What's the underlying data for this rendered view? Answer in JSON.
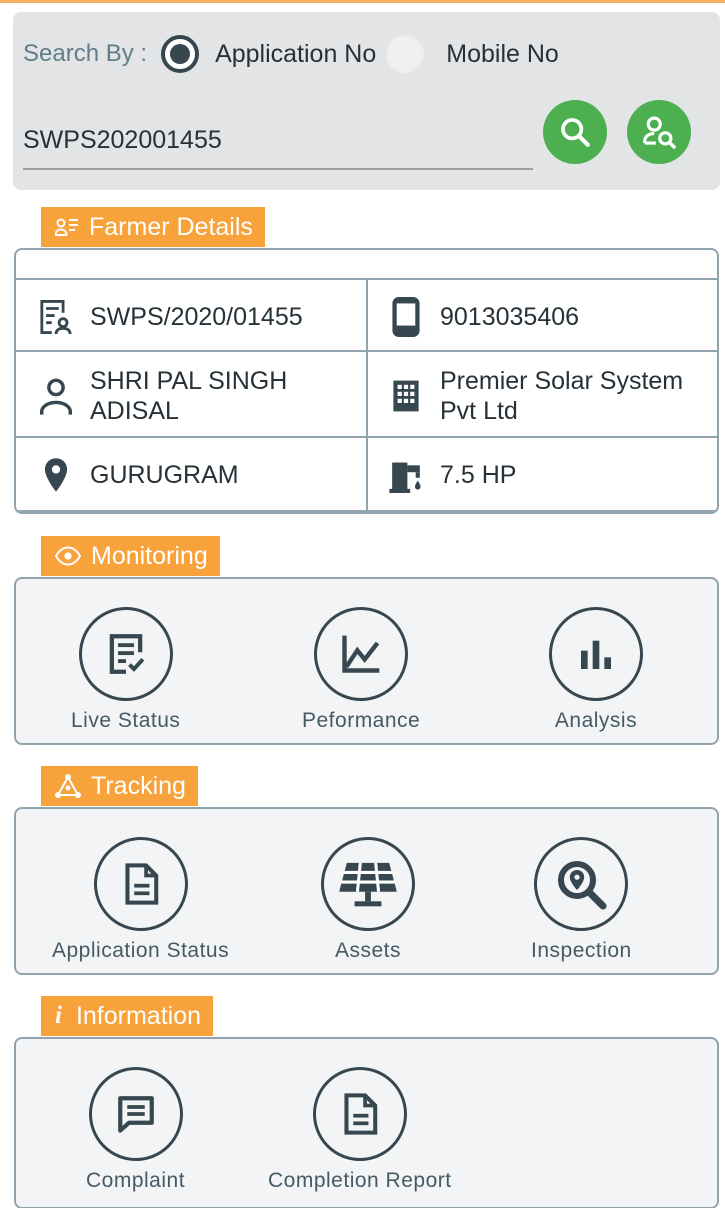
{
  "search": {
    "label": "Search By :",
    "option_application": "Application No",
    "option_mobile": "Mobile No",
    "selected": "Application No",
    "value": "SWPS202001455",
    "search_icon": "search-icon",
    "user_search_icon": "user-search-icon"
  },
  "farmer": {
    "title": "Farmer Details",
    "application_no": "SWPS/2020/01455",
    "mobile": "9013035406",
    "name_line1": "SHRI PAL SINGH",
    "name_line2": "ADISAL",
    "vendor_line1": "Premier Solar System",
    "vendor_line2": "Pvt Ltd",
    "district": "GURUGRAM",
    "pump_capacity": "7.5 HP"
  },
  "monitoring": {
    "title": "Monitoring",
    "items": [
      {
        "label": "Live Status",
        "icon": "checklist-icon"
      },
      {
        "label": "Peformance",
        "icon": "line-chart-icon"
      },
      {
        "label": "Analysis",
        "icon": "bar-chart-icon"
      }
    ]
  },
  "tracking": {
    "title": "Tracking",
    "items": [
      {
        "label": "Application Status",
        "icon": "document-icon"
      },
      {
        "label": "Assets",
        "icon": "solar-panel-icon"
      },
      {
        "label": "Inspection",
        "icon": "location-search-icon"
      }
    ]
  },
  "information": {
    "title": "Information",
    "items": [
      {
        "label": "Complaint",
        "icon": "chat-icon"
      },
      {
        "label": "Completion Report",
        "icon": "document-icon"
      }
    ]
  },
  "colors": {
    "accent": "#f7a23a",
    "green": "#4caf50",
    "dark": "#37474f",
    "border": "#90a4ae"
  }
}
